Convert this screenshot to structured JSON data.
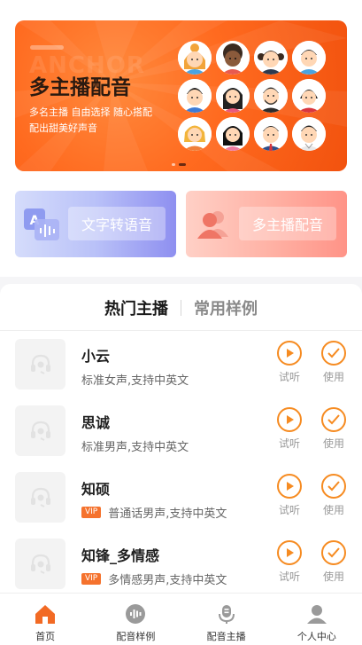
{
  "banner": {
    "watermark": "ANCHOR",
    "title": "多主播配音",
    "subtitle_line1": "多名主播  自由选择  随心搭配",
    "subtitle_line2": "配出甜美好声音",
    "page_index": 2,
    "page_count": 2
  },
  "features": {
    "tts": {
      "label": "文字转语音"
    },
    "multi": {
      "label": "多主播配音"
    }
  },
  "tabs": {
    "hot": "热门主播",
    "common": "常用样例",
    "active": "hot"
  },
  "anchors": [
    {
      "name": "小云",
      "vip": "",
      "desc": "标准女声,支持中英文",
      "play_label": "试听",
      "use_label": "使用"
    },
    {
      "name": "思诚",
      "vip": "",
      "desc": "标准男声,支持中英文",
      "play_label": "试听",
      "use_label": "使用"
    },
    {
      "name": "知硕",
      "vip": "VIP",
      "desc": "普通话男声,支持中英文",
      "play_label": "试听",
      "use_label": "使用"
    },
    {
      "name": "知锋_多情感",
      "vip": "VIP",
      "desc": "多情感男声,支持中英文",
      "play_label": "试听",
      "use_label": "使用"
    }
  ],
  "nav": {
    "home": "首页",
    "samples": "配音样例",
    "anchors": "配音主播",
    "profile": "个人中心",
    "active": "home"
  },
  "colors": {
    "accent": "#f68b21",
    "banner": "#ff6a1f",
    "vip": "#f5722d"
  }
}
